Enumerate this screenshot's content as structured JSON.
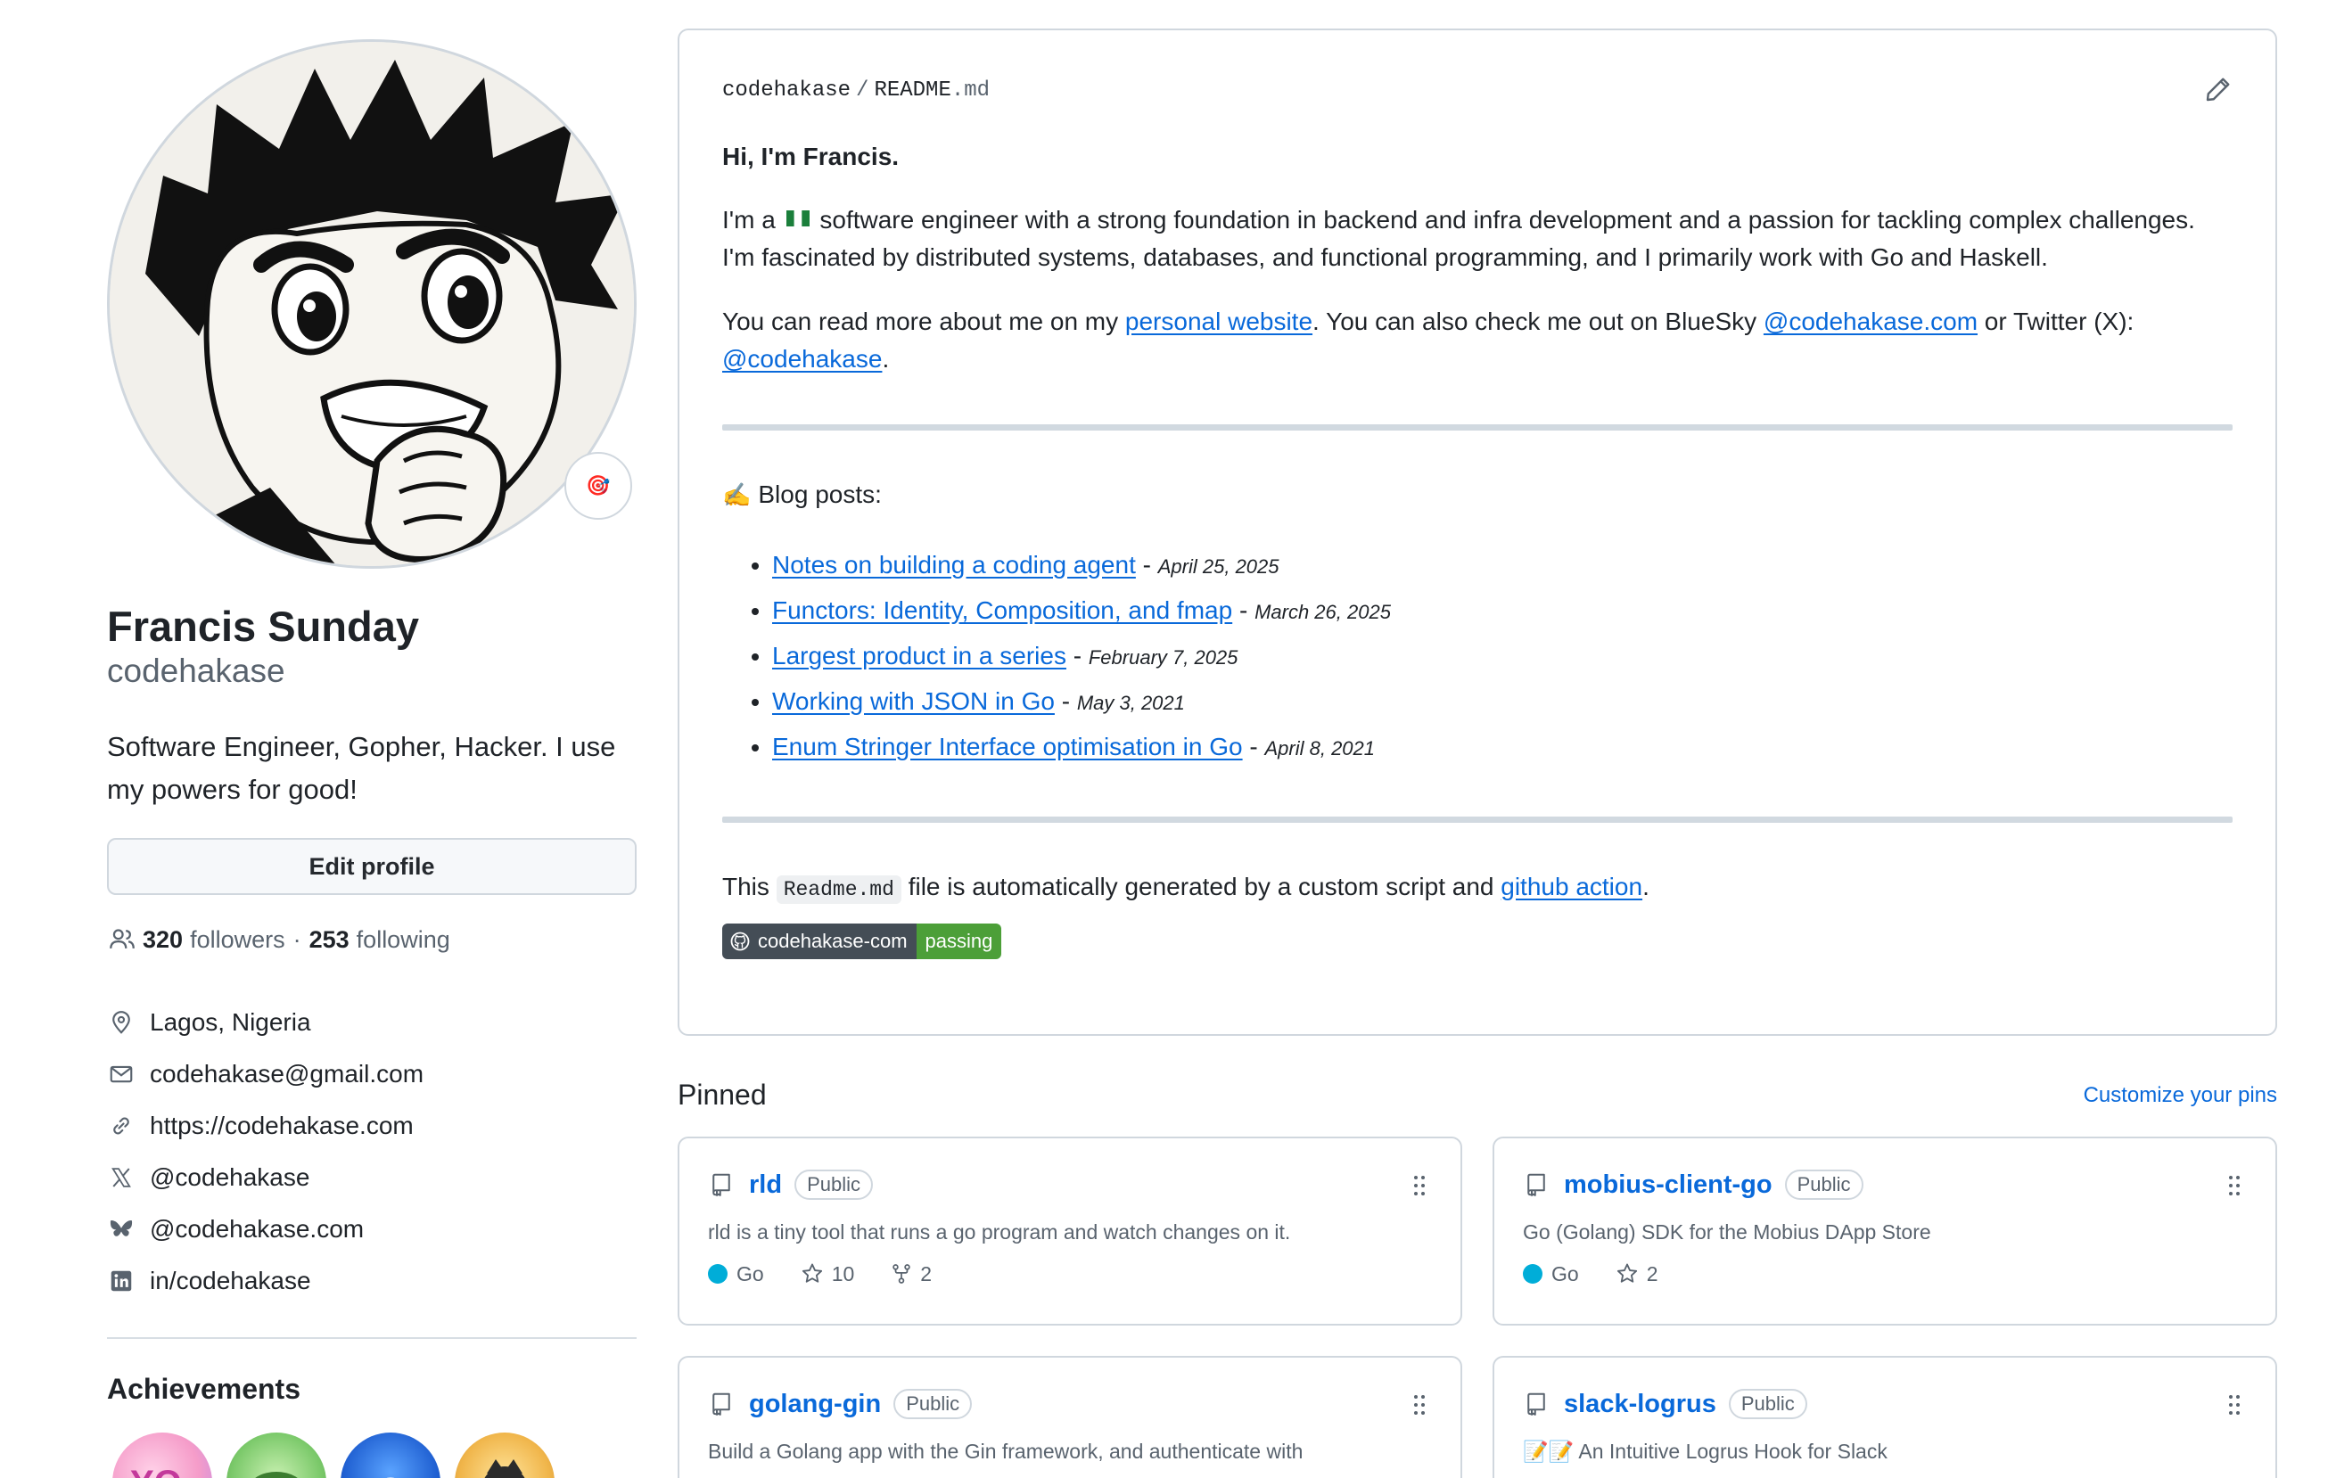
{
  "profile": {
    "full_name": "Francis Sunday",
    "login": "codehakase",
    "bio": "Software Engineer, Gopher, Hacker. I use my powers for good!",
    "status_emoji": "🎯",
    "edit_label": "Edit profile",
    "followers_count": "320",
    "followers_label": "followers",
    "separator": "·",
    "following_count": "253",
    "following_label": "following",
    "details": [
      {
        "icon": "location-icon",
        "text": "Lagos, Nigeria"
      },
      {
        "icon": "mail-icon",
        "text": "codehakase@gmail.com"
      },
      {
        "icon": "link-icon",
        "text": "https://codehakase.com"
      },
      {
        "icon": "x-twitter-icon",
        "text": "@codehakase"
      },
      {
        "icon": "bluesky-icon",
        "text": "@codehakase.com"
      },
      {
        "icon": "linkedin-icon",
        "text": "in/codehakase"
      }
    ],
    "achievements_title": "Achievements"
  },
  "readme": {
    "owner": "codehakase",
    "slash": "/",
    "file_base": "README",
    "file_ext": ".md",
    "heading": "Hi, I'm Francis.",
    "intro_a": "I'm a",
    "intro_b": "software engineer with a strong foundation in backend and infra development and a passion for tackling complex challenges. I'm fascinated by distributed systems, databases, and functional programming, and I primarily work with Go and Haskell.",
    "more_a": "You can read more about me on my",
    "more_link1": "personal website",
    "more_b": ". You can also check me out on BlueSky",
    "more_link2": "@codehakase.com",
    "more_c": "or Twitter (X):",
    "more_link3": "@codehakase",
    "more_d": ".",
    "blog_emoji": "✍️",
    "blog_title": "Blog posts:",
    "posts": [
      {
        "title": "Notes on building a coding agent",
        "date": "April 25, 2025"
      },
      {
        "title": "Functors: Identity, Composition, and fmap",
        "date": "March 26, 2025"
      },
      {
        "title": "Largest product in a series",
        "date": "February 7, 2025"
      },
      {
        "title": "Working with JSON in Go",
        "date": "May 3, 2021"
      },
      {
        "title": "Enum Stringer Interface optimisation in Go",
        "date": "April 8, 2021"
      }
    ],
    "dash": "-",
    "foot_a": "This",
    "foot_code": "Readme.md",
    "foot_b": "file is automatically generated by a custom script and",
    "foot_link": "github action",
    "foot_c": ".",
    "ci_name": "codehakase-com",
    "ci_status": "passing"
  },
  "pinned": {
    "title": "Pinned",
    "customize": "Customize your pins",
    "repos": [
      {
        "name": "rld",
        "visibility": "Public",
        "description": "rld is a tiny tool that runs a go program and watch changes on it.",
        "language": "Go",
        "stars": "10",
        "forks": "2"
      },
      {
        "name": "mobius-client-go",
        "visibility": "Public",
        "description": "Go (Golang) SDK for the Mobius DApp Store",
        "language": "Go",
        "stars": "2",
        "forks": ""
      },
      {
        "name": "golang-gin",
        "visibility": "Public",
        "description": "Build a Golang app with the Gin framework, and authenticate with",
        "language": "",
        "stars": "",
        "forks": ""
      },
      {
        "name": "slack-logrus",
        "visibility": "Public",
        "description": "📝📝 An Intuitive Logrus Hook for Slack",
        "language": "",
        "stars": "",
        "forks": ""
      }
    ]
  },
  "colors": {
    "link": "#0969da",
    "go_language": "#00add8",
    "ci_passing": "#4c9f38"
  }
}
